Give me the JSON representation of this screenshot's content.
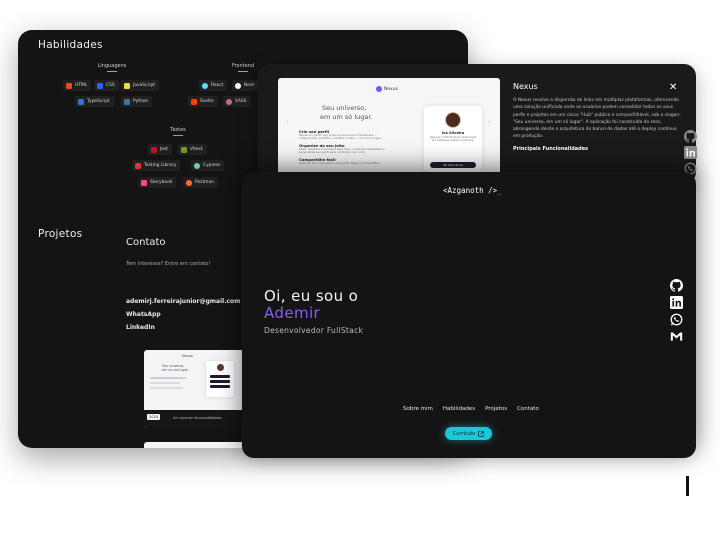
{
  "skills": {
    "title": "Habilidades",
    "groups": {
      "languages": {
        "title": "Linguagens",
        "items": [
          {
            "label": "HTML",
            "color": "#e34c26"
          },
          {
            "label": "CSS",
            "color": "#2965f1"
          },
          {
            "label": "JavaScript",
            "color": "#f0db4f"
          },
          {
            "label": "TypeScript",
            "color": "#3178c6"
          },
          {
            "label": "Python",
            "color": "#3776ab"
          }
        ]
      },
      "frontend": {
        "title": "Frontend",
        "items": [
          {
            "label": "React",
            "color": "#61dafb"
          },
          {
            "label": "Next",
            "color": "#ffffff"
          },
          {
            "label": "Svelte",
            "color": "#ff3e00"
          },
          {
            "label": "SASS",
            "color": "#cc6699"
          }
        ]
      },
      "tests": {
        "title": "Testes",
        "items": [
          {
            "label": "Jest",
            "color": "#c21325"
          },
          {
            "label": "Vitest",
            "color": "#729b1b"
          },
          {
            "label": "Testing Library",
            "color": "#e33332"
          },
          {
            "label": "Cypress",
            "color": "#69d3a7"
          },
          {
            "label": "Storybook",
            "color": "#ff4785"
          },
          {
            "label": "Postman",
            "color": "#ff6c37"
          }
        ]
      }
    }
  },
  "projects": {
    "title": "Projetos"
  },
  "contact": {
    "title": "Contato",
    "prompt": "Tem interesse? Entre em contato!",
    "email": "ademirj.ferreirajunior@gmail.com",
    "whatsapp": "WhatsApp",
    "linkedin": "LinkedIn"
  },
  "project_thumb": {
    "brand": "Nexus",
    "headline_1": "Seu universo,",
    "headline_2": "em um só lugar.",
    "year": "2025",
    "caption": "Um conector de possibilidades"
  },
  "modal": {
    "title": "Nexus",
    "description": "O Nexus resolve a dispersão de links em múltiplas plataformas, oferecendo uma solução unificada onde os usuários podem consolidar todos os seus perfis e projetos em um único \"Hub\" público e compartilhável, sob o slogan: \"Seu universo, em um só lugar\". A aplicação foi construída do zero, abrangendo desde a arquitetura do banco de dados até o deploy contínuo em produção.",
    "subheading": "Principais Funcionalidades",
    "close": "✕",
    "preview": {
      "brand": "Nexus",
      "headline_1": "Seu universo,",
      "headline_2": "em um só lugar.",
      "features": [
        {
          "title": "Crie seu perfil",
          "text": "Monte um perfil com todos os seus links importantes — redes sociais, portfólio, contatos e mais — em um só lugar."
        },
        {
          "title": "Organize do seu jeito",
          "text": "Ative, desative e reordene seus links, conteúdo visualizado e personalize seu perfil para combinar com você."
        },
        {
          "title": "Compartilhe fácil",
          "text": "Gere um link único para o seu perfil digital e compartilhe..."
        }
      ],
      "profile_name": "Iva Silveira",
      "profile_bio": "Designer multidisciplinar apaixonada por interfaces digitais e branding.",
      "profile_button": "Ver links da Iva"
    }
  },
  "hero": {
    "logo_text": "<Azganoth />",
    "greeting": "Oi, eu sou o",
    "name": "Ademir",
    "role": "Desenvolvedor FullStack",
    "nav": [
      "Sobre mim",
      "Habilidades",
      "Projetos",
      "Contato"
    ],
    "cta": "Currículo",
    "socials": [
      "github-icon",
      "linkedin-icon",
      "whatsapp-icon",
      "gmail-icon"
    ]
  },
  "colors": {
    "accent_purple": "#8a5cf6",
    "accent_cyan": "#1ec6d9",
    "card_bg": "#141414"
  }
}
